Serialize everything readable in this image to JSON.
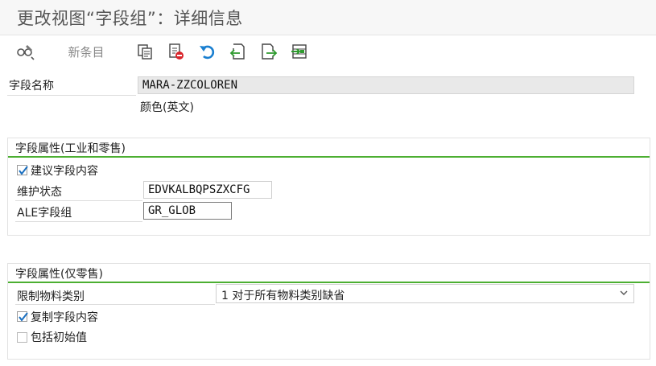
{
  "window": {
    "title": "更改视图“字段组”：详细信息"
  },
  "toolbar": {
    "new_entries_label": "新条目",
    "icons": [
      "glasses-edit-icon",
      "copy-icon",
      "delete-icon",
      "undo-icon",
      "previous-entry-icon",
      "next-entry-icon",
      "select-all-icon"
    ]
  },
  "field_name": {
    "label": "字段名称",
    "value": "MARA-ZZCOLOREN",
    "description": "颜色(英文)"
  },
  "group_industry_retail": {
    "title": "字段属性(工业和零售)",
    "propose_content": {
      "label": "建议字段内容",
      "checked": true
    },
    "maintenance_status": {
      "label": "维护状态",
      "value": "EDVKALBQPSZXCFG"
    },
    "ale_field_group": {
      "label": "ALE字段组",
      "value": "GR_GLOB"
    }
  },
  "group_retail_only": {
    "title": "字段属性(仅零售)",
    "restrict_material_type": {
      "label": "限制物料类别",
      "value": "1 对于所有物料类别缺省"
    },
    "copy_content": {
      "label": "复制字段内容",
      "checked": true
    },
    "include_initial": {
      "label": "包括初始值",
      "checked": false
    }
  },
  "colors": {
    "accent_green": "#4caf32",
    "icon_blue": "#1a7fd0",
    "icon_red": "#d9252b"
  }
}
